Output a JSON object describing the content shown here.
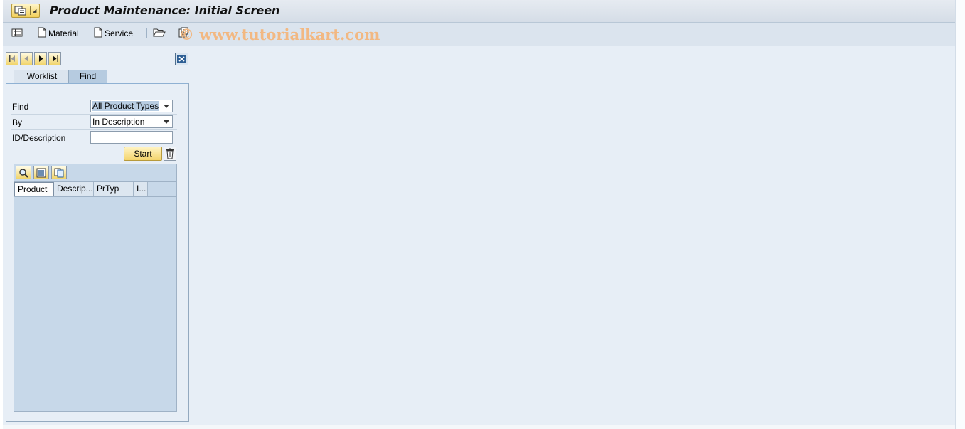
{
  "window": {
    "title": "Product Maintenance: Initial Screen",
    "menu_icon": "sap-menu-icon"
  },
  "toolbar": {
    "items": [
      {
        "icon": "list-icon",
        "label": ""
      },
      {
        "icon": "document-icon",
        "label": "Material"
      },
      {
        "icon": "document-icon",
        "label": "Service"
      },
      {
        "icon": "open-folder-icon",
        "label": ""
      },
      {
        "icon": "settings-icon",
        "label": ""
      }
    ],
    "watermark": "© www.tutorialkart.com"
  },
  "nav": {
    "buttons": [
      "first-page-icon",
      "previous-page-icon",
      "next-page-icon",
      "last-page-icon"
    ],
    "close_icon": "close-icon"
  },
  "tabs": [
    {
      "label": "Worklist",
      "active": false
    },
    {
      "label": "Find",
      "active": true
    }
  ],
  "find": {
    "find_label": "Find",
    "find_value": "All Product Types",
    "by_label": "By",
    "by_value": "In Description",
    "id_label": "ID/Description",
    "id_value": "",
    "start_label": "Start",
    "clear_icon": "trash-icon"
  },
  "results": {
    "tool_icons": [
      "find-icon",
      "select-icon",
      "copy-icon"
    ],
    "columns": [
      "Product",
      "Descrip...",
      "PrTyp",
      "I..."
    ]
  },
  "colors": {
    "background": "#e7eef6",
    "button_yellow": "#f4d46c",
    "watermark": "#f2b882"
  }
}
